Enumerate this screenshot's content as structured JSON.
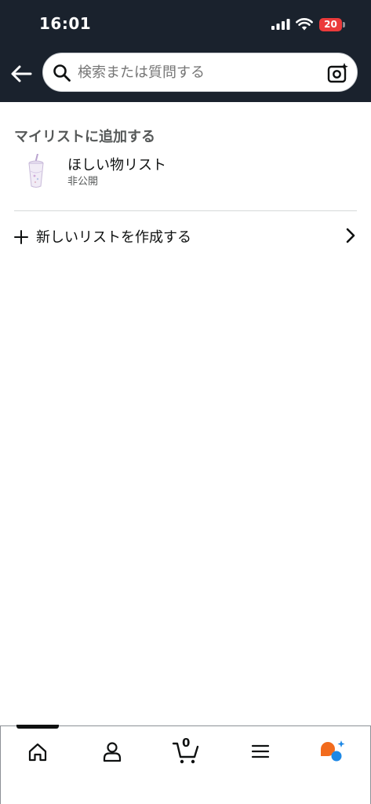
{
  "status_bar": {
    "time": "16:01",
    "battery_level": "20",
    "battery_color": "#eb3b3b"
  },
  "header": {
    "background": "#1a222d",
    "back_icon": "arrow-left-icon",
    "search": {
      "placeholder": "検索または質問する",
      "value": ""
    },
    "camera_icon": "camera-sparkle-icon"
  },
  "main": {
    "section_title": "マイリストに追加する",
    "lists": [
      {
        "name": "ほしい物リスト",
        "privacy": "非公開",
        "thumbnail": "tumbler-cup-thumbnail"
      }
    ],
    "create_list": {
      "label": "新しいリストを作成する",
      "icon": "plus-icon",
      "chevron": "chevron-right-icon"
    }
  },
  "bottom_nav": {
    "items": [
      {
        "name": "home",
        "icon": "home-icon",
        "active": true
      },
      {
        "name": "account",
        "icon": "person-icon"
      },
      {
        "name": "cart",
        "icon": "cart-icon",
        "count": "0"
      },
      {
        "name": "menu",
        "icon": "hamburger-icon"
      },
      {
        "name": "assistant",
        "icon": "assistant-sparkle-icon"
      }
    ],
    "accent_colors": {
      "orange": "#f26b1d",
      "blue": "#1e88e5"
    }
  }
}
